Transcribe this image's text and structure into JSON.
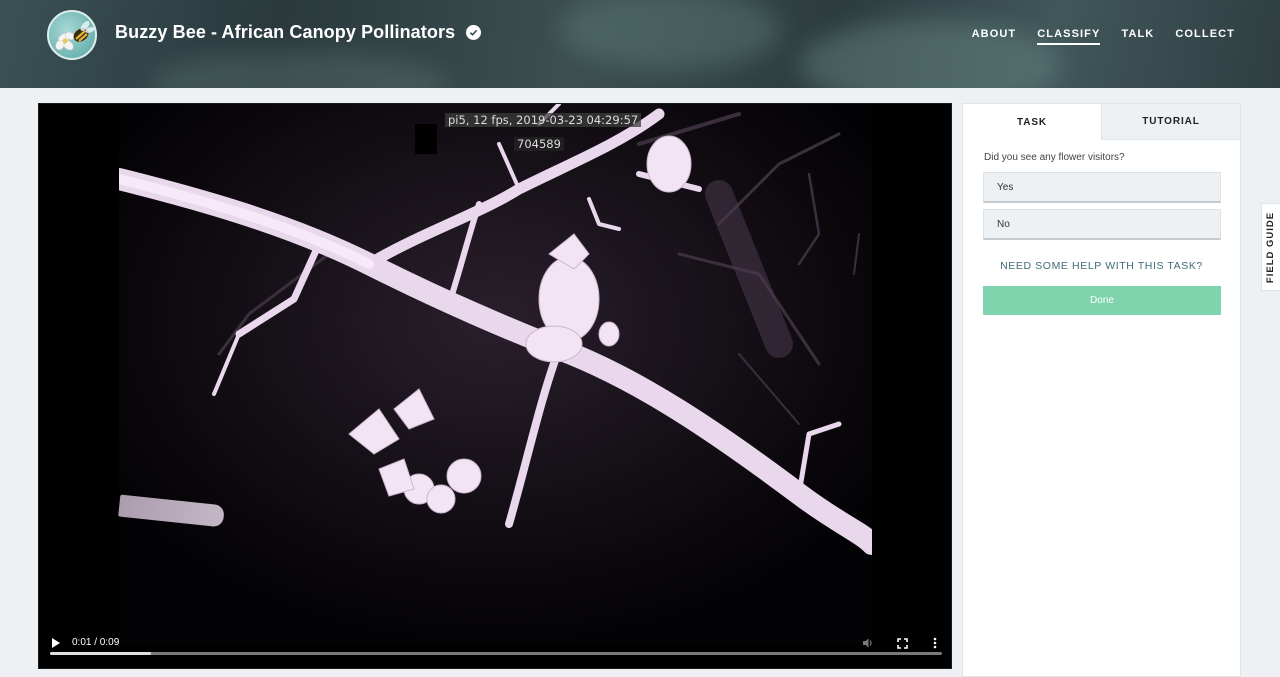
{
  "header": {
    "project_title": "Buzzy Bee - African Canopy Pollinators",
    "nav": [
      {
        "label": "ABOUT",
        "active": false
      },
      {
        "label": "CLASSIFY",
        "active": true
      },
      {
        "label": "TALK",
        "active": false
      },
      {
        "label": "COLLECT",
        "active": false
      }
    ]
  },
  "video": {
    "overlay_caption": "pi5, 12 fps, 2019-03-23 04:29:57",
    "overlay_frame": "704589",
    "time": "0:01 / 0:09",
    "progress": 0.113
  },
  "task": {
    "tabs": [
      {
        "label": "TASK",
        "active": true
      },
      {
        "label": "TUTORIAL",
        "active": false
      }
    ],
    "question": "Did you see any flower visitors?",
    "answers": [
      "Yes",
      "No"
    ],
    "help_label": "NEED SOME HELP WITH THIS TASK?",
    "done_label": "Done"
  },
  "field_guide_label": "FIELD GUIDE",
  "colors": {
    "done": "#7fd4ad",
    "help_link": "#3e6a78"
  },
  "icons": [
    "verified-badge-icon",
    "play-icon",
    "volume-icon",
    "fullscreen-icon",
    "more-options-icon"
  ]
}
